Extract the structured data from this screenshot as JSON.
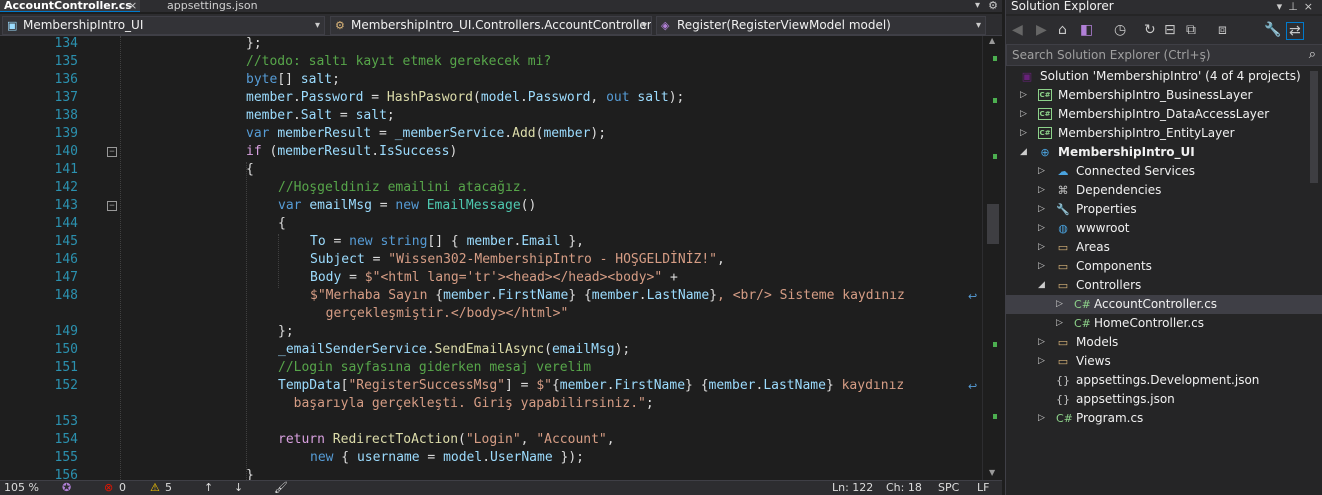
{
  "tabs": {
    "active": "AccountController.cs",
    "second": "appsettings.json",
    "close_glyph": "×"
  },
  "navbar": {
    "project": "MembershipIntro_UI",
    "class": "MembershipIntro_UI.Controllers.AccountController",
    "member": "Register(RegisterViewModel model)"
  },
  "code_lines": [
    {
      "n": "134",
      "indent": 0,
      "tokens": [
        [
          "p",
          "};"
        ]
      ]
    },
    {
      "n": "135",
      "indent": 0,
      "tokens": [
        [
          "c",
          "//todo: saltı kayıt etmek gerekecek mi?"
        ]
      ]
    },
    {
      "n": "136",
      "indent": 0,
      "tokens": [
        [
          "k",
          "byte"
        ],
        [
          "p",
          "[] "
        ],
        [
          "v",
          "salt"
        ],
        [
          "p",
          ";"
        ]
      ]
    },
    {
      "n": "137",
      "indent": 0,
      "tokens": [
        [
          "v",
          "member"
        ],
        [
          "p",
          "."
        ],
        [
          "v",
          "Password"
        ],
        [
          "p",
          " = "
        ],
        [
          "m",
          "HashPasword"
        ],
        [
          "p",
          "("
        ],
        [
          "v",
          "model"
        ],
        [
          "p",
          "."
        ],
        [
          "v",
          "Password"
        ],
        [
          "p",
          ", "
        ],
        [
          "k",
          "out"
        ],
        [
          "p",
          " "
        ],
        [
          "v",
          "salt"
        ],
        [
          "p",
          ");"
        ]
      ]
    },
    {
      "n": "138",
      "indent": 0,
      "tokens": [
        [
          "v",
          "member"
        ],
        [
          "p",
          "."
        ],
        [
          "v",
          "Salt"
        ],
        [
          "p",
          " = "
        ],
        [
          "v",
          "salt"
        ],
        [
          "p",
          ";"
        ]
      ]
    },
    {
      "n": "139",
      "indent": 0,
      "tokens": [
        [
          "k",
          "var"
        ],
        [
          "p",
          " "
        ],
        [
          "v",
          "memberResult"
        ],
        [
          "p",
          " = "
        ],
        [
          "v",
          "_memberService"
        ],
        [
          "p",
          "."
        ],
        [
          "m",
          "Add"
        ],
        [
          "p",
          "("
        ],
        [
          "v",
          "member"
        ],
        [
          "p",
          ");"
        ]
      ]
    },
    {
      "n": "140",
      "indent": 0,
      "fold": true,
      "tokens": [
        [
          "kc",
          "if"
        ],
        [
          "p",
          " ("
        ],
        [
          "v",
          "memberResult"
        ],
        [
          "p",
          "."
        ],
        [
          "v",
          "IsSuccess"
        ],
        [
          "p",
          ")"
        ]
      ]
    },
    {
      "n": "141",
      "indent": 0,
      "tokens": [
        [
          "p",
          "{"
        ]
      ]
    },
    {
      "n": "142",
      "indent": 1,
      "tokens": [
        [
          "c",
          "//Hoşgeldiniz emailini atacağız."
        ]
      ]
    },
    {
      "n": "143",
      "indent": 1,
      "fold": true,
      "tokens": [
        [
          "k",
          "var"
        ],
        [
          "p",
          " "
        ],
        [
          "v",
          "emailMsg"
        ],
        [
          "p",
          " = "
        ],
        [
          "k",
          "new"
        ],
        [
          "p",
          " "
        ],
        [
          "t",
          "EmailMessage"
        ],
        [
          "p",
          "()"
        ]
      ]
    },
    {
      "n": "144",
      "indent": 1,
      "tokens": [
        [
          "p",
          "{"
        ]
      ]
    },
    {
      "n": "145",
      "indent": 2,
      "tokens": [
        [
          "v",
          "To"
        ],
        [
          "p",
          " = "
        ],
        [
          "k",
          "new"
        ],
        [
          "p",
          " "
        ],
        [
          "k",
          "string"
        ],
        [
          "p",
          "[] { "
        ],
        [
          "v",
          "member"
        ],
        [
          "p",
          "."
        ],
        [
          "v",
          "Email"
        ],
        [
          "p",
          " },"
        ]
      ]
    },
    {
      "n": "146",
      "indent": 2,
      "tokens": [
        [
          "v",
          "Subject"
        ],
        [
          "p",
          " = "
        ],
        [
          "s",
          "\"Wissen302-MembershipIntro - HOŞGELDİNİZ!\""
        ],
        [
          "p",
          ","
        ]
      ]
    },
    {
      "n": "147",
      "indent": 2,
      "tokens": [
        [
          "v",
          "Body"
        ],
        [
          "p",
          " = "
        ],
        [
          "s",
          "$\"<html lang='tr'><head></head><body>\""
        ],
        [
          "p",
          " +"
        ]
      ]
    },
    {
      "n": "148",
      "indent": 2,
      "wrap": true,
      "tokens": [
        [
          "s",
          "$\"Merhaba Sayın "
        ],
        [
          "p",
          "{"
        ],
        [
          "v",
          "member"
        ],
        [
          "p",
          "."
        ],
        [
          "v",
          "FirstName"
        ],
        [
          "p",
          "}"
        ],
        [
          "s",
          " "
        ],
        [
          "p",
          "{"
        ],
        [
          "v",
          "member"
        ],
        [
          "p",
          "."
        ],
        [
          "v",
          "LastName"
        ],
        [
          "p",
          "}"
        ],
        [
          "s",
          ", <br/> Sisteme kaydınız"
        ]
      ]
    },
    {
      "n": "",
      "indent": 2,
      "cont": true,
      "tokens": [
        [
          "s",
          "  gerçekleşmiştir.</body></html>\""
        ]
      ]
    },
    {
      "n": "149",
      "indent": 1,
      "tokens": [
        [
          "p",
          "};"
        ]
      ]
    },
    {
      "n": "150",
      "indent": 1,
      "tokens": [
        [
          "v",
          "_emailSenderService"
        ],
        [
          "p",
          "."
        ],
        [
          "m",
          "SendEmailAsync"
        ],
        [
          "p",
          "("
        ],
        [
          "v",
          "emailMsg"
        ],
        [
          "p",
          ");"
        ]
      ]
    },
    {
      "n": "151",
      "indent": 1,
      "tokens": [
        [
          "c",
          "//Login sayfasına giderken mesaj verelim"
        ]
      ]
    },
    {
      "n": "152",
      "indent": 1,
      "wrap": true,
      "tokens": [
        [
          "v",
          "TempData"
        ],
        [
          "p",
          "["
        ],
        [
          "s",
          "\"RegisterSuccessMsg\""
        ],
        [
          "p",
          "] = "
        ],
        [
          "s",
          "$\""
        ],
        [
          "p",
          "{"
        ],
        [
          "v",
          "member"
        ],
        [
          "p",
          "."
        ],
        [
          "v",
          "FirstName"
        ],
        [
          "p",
          "}"
        ],
        [
          "s",
          " "
        ],
        [
          "p",
          "{"
        ],
        [
          "v",
          "member"
        ],
        [
          "p",
          "."
        ],
        [
          "v",
          "LastName"
        ],
        [
          "p",
          "}"
        ],
        [
          "s",
          " kaydınız"
        ]
      ]
    },
    {
      "n": "",
      "indent": 1,
      "cont": true,
      "tokens": [
        [
          "s",
          "  başarıyla gerçekleşti. Giriş yapabilirsiniz.\""
        ],
        [
          "p",
          ";"
        ]
      ]
    },
    {
      "n": "153",
      "indent": 1,
      "tokens": []
    },
    {
      "n": "154",
      "indent": 1,
      "tokens": [
        [
          "kc",
          "return"
        ],
        [
          "p",
          " "
        ],
        [
          "m",
          "RedirectToAction"
        ],
        [
          "p",
          "("
        ],
        [
          "s",
          "\"Login\""
        ],
        [
          "p",
          ", "
        ],
        [
          "s",
          "\"Account\""
        ],
        [
          "p",
          ","
        ]
      ]
    },
    {
      "n": "155",
      "indent": 2,
      "tokens": [
        [
          "k",
          "new"
        ],
        [
          "p",
          " { "
        ],
        [
          "v",
          "username"
        ],
        [
          "p",
          " = "
        ],
        [
          "v",
          "model"
        ],
        [
          "p",
          "."
        ],
        [
          "v",
          "UserName"
        ],
        [
          "p",
          " });"
        ]
      ]
    },
    {
      "n": "156",
      "indent": 0,
      "tokens": [
        [
          "p",
          "}"
        ]
      ]
    }
  ],
  "statusbar": {
    "zoom": "105 %",
    "errors": "0",
    "warnings": "5",
    "line": "Ln: 122",
    "col": "Ch: 18",
    "spc": "SPC",
    "lf": "LF"
  },
  "solution_explorer": {
    "title": "Solution Explorer",
    "search_placeholder": "Search Solution Explorer (Ctrl+ş)",
    "nodes": [
      {
        "label": "Solution 'MembershipIntro' (4 of 4 projects)",
        "level": 0,
        "icon": "solution-icon",
        "arrow": ""
      },
      {
        "label": "MembershipIntro_BusinessLayer",
        "level": 1,
        "icon": "csharp-project-icon",
        "arrow": "right"
      },
      {
        "label": "MembershipIntro_DataAccessLayer",
        "level": 1,
        "icon": "csharp-project-icon",
        "arrow": "right"
      },
      {
        "label": "MembershipIntro_EntityLayer",
        "level": 1,
        "icon": "csharp-project-icon",
        "arrow": "right"
      },
      {
        "label": "MembershipIntro_UI",
        "level": 1,
        "icon": "web-project-icon",
        "arrow": "down",
        "bold": true
      },
      {
        "label": "Connected Services",
        "level": 2,
        "icon": "connected-services-icon",
        "arrow": "right"
      },
      {
        "label": "Dependencies",
        "level": 2,
        "icon": "dependencies-icon",
        "arrow": "right"
      },
      {
        "label": "Properties",
        "level": 2,
        "icon": "properties-icon",
        "arrow": "right"
      },
      {
        "label": "wwwroot",
        "level": 2,
        "icon": "globe-icon",
        "arrow": "right"
      },
      {
        "label": "Areas",
        "level": 2,
        "icon": "folder-icon",
        "arrow": "right"
      },
      {
        "label": "Components",
        "level": 2,
        "icon": "folder-icon",
        "arrow": "right"
      },
      {
        "label": "Controllers",
        "level": 2,
        "icon": "folder-icon",
        "arrow": "down"
      },
      {
        "label": "AccountController.cs",
        "level": 3,
        "icon": "csharp-file-icon",
        "arrow": "right",
        "selected": true
      },
      {
        "label": "HomeController.cs",
        "level": 3,
        "icon": "csharp-file-icon",
        "arrow": "right"
      },
      {
        "label": "Models",
        "level": 2,
        "icon": "folder-icon",
        "arrow": "right"
      },
      {
        "label": "Views",
        "level": 2,
        "icon": "folder-icon",
        "arrow": "right"
      },
      {
        "label": "appsettings.Development.json",
        "level": 2,
        "icon": "json-file-icon",
        "arrow": ""
      },
      {
        "label": "appsettings.json",
        "level": 2,
        "icon": "json-file-icon",
        "arrow": ""
      },
      {
        "label": "Program.cs",
        "level": 2,
        "icon": "csharp-file-icon",
        "arrow": "right"
      }
    ]
  },
  "colors": {
    "accent": "#007acc",
    "comment": "#57a64a",
    "keyword": "#569cd6",
    "control_keyword": "#d8a0df",
    "string": "#d69d85",
    "type": "#4ec9b0",
    "method": "#dcdcaa",
    "variable": "#9cdcfe"
  }
}
